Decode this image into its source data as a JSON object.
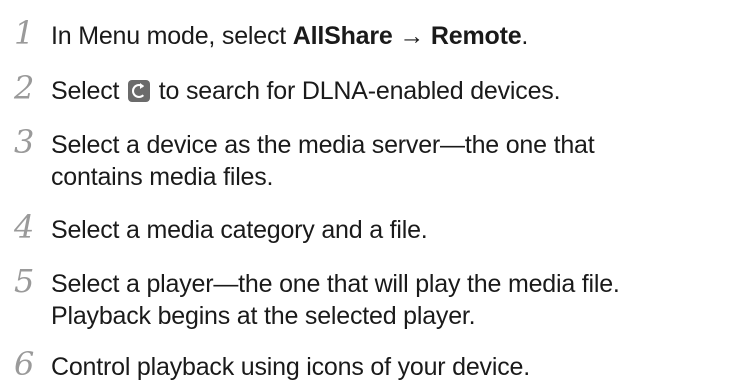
{
  "steps": [
    {
      "number": "1",
      "before": "In Menu mode, select ",
      "bold1": "AllShare",
      "arrow": " → ",
      "bold2": "Remote",
      "after": "."
    },
    {
      "number": "2",
      "before": "Select ",
      "icon": "search-refresh-icon",
      "after": " to search for DLNA-enabled devices."
    },
    {
      "number": "3",
      "line1": "Select a device as the media server—the one that",
      "line2": "contains media files."
    },
    {
      "number": "4",
      "text": "Select a media category and a file."
    },
    {
      "number": "5",
      "line1": "Select a player—the one that will play the media file.",
      "line2": "Playback begins at the selected player."
    },
    {
      "number": "6",
      "text": "Control playback using icons of your device."
    }
  ]
}
